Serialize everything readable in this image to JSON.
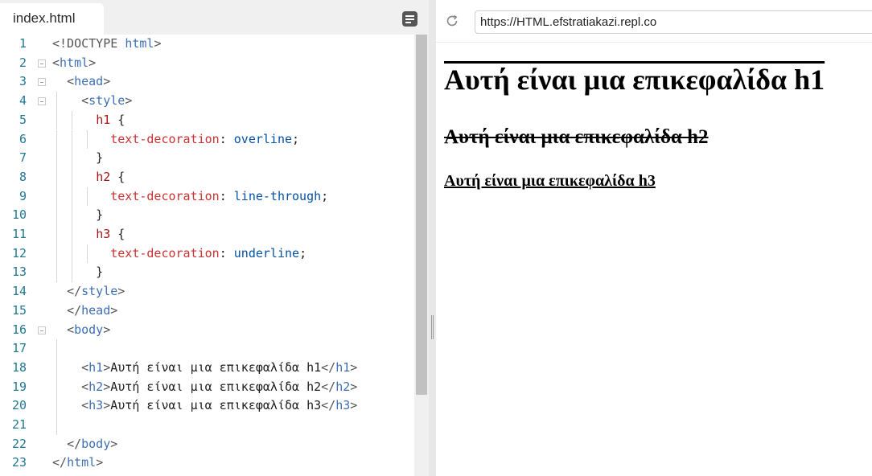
{
  "editor": {
    "filename": "index.html",
    "menu_icon": "menu-icon",
    "lines": [
      {
        "no": "1",
        "fold": false,
        "guides": [],
        "tokens": [
          [
            "t-br",
            "<!DOCTYPE "
          ],
          [
            "t-tag",
            "html"
          ],
          [
            "t-br",
            ">"
          ]
        ]
      },
      {
        "no": "2",
        "fold": true,
        "guides": [],
        "tokens": [
          [
            "t-br",
            "<"
          ],
          [
            "t-tag",
            "html"
          ],
          [
            "t-br",
            ">"
          ]
        ]
      },
      {
        "no": "3",
        "fold": true,
        "guides": [],
        "tokens": [
          [
            "t-txt",
            "  "
          ],
          [
            "t-br",
            "<"
          ],
          [
            "t-tag",
            "head"
          ],
          [
            "t-br",
            ">"
          ]
        ]
      },
      {
        "no": "4",
        "fold": true,
        "guides": [
          1
        ],
        "tokens": [
          [
            "t-txt",
            "    "
          ],
          [
            "t-br",
            "<"
          ],
          [
            "t-tag",
            "style"
          ],
          [
            "t-br",
            ">"
          ]
        ]
      },
      {
        "no": "5",
        "fold": false,
        "guides": [
          1,
          2
        ],
        "tokens": [
          [
            "t-txt",
            "      "
          ],
          [
            "t-sel",
            "h1"
          ],
          [
            "t-txt",
            " {"
          ]
        ]
      },
      {
        "no": "6",
        "fold": false,
        "guides": [
          1,
          2,
          3
        ],
        "tokens": [
          [
            "t-txt",
            "        "
          ],
          [
            "t-prop",
            "text-decoration"
          ],
          [
            "t-txt",
            ": "
          ],
          [
            "t-val",
            "overline"
          ],
          [
            "t-txt",
            ";"
          ]
        ]
      },
      {
        "no": "7",
        "fold": false,
        "guides": [
          1,
          2
        ],
        "tokens": [
          [
            "t-txt",
            "      }"
          ]
        ]
      },
      {
        "no": "8",
        "fold": false,
        "guides": [
          1,
          2
        ],
        "tokens": [
          [
            "t-txt",
            "      "
          ],
          [
            "t-sel",
            "h2"
          ],
          [
            "t-txt",
            " {"
          ]
        ]
      },
      {
        "no": "9",
        "fold": false,
        "guides": [
          1,
          2,
          3
        ],
        "tokens": [
          [
            "t-txt",
            "        "
          ],
          [
            "t-prop",
            "text-decoration"
          ],
          [
            "t-txt",
            ": "
          ],
          [
            "t-val",
            "line-through"
          ],
          [
            "t-txt",
            ";"
          ]
        ]
      },
      {
        "no": "10",
        "fold": false,
        "guides": [
          1,
          2
        ],
        "tokens": [
          [
            "t-txt",
            "      }"
          ]
        ]
      },
      {
        "no": "11",
        "fold": false,
        "guides": [
          1,
          2
        ],
        "tokens": [
          [
            "t-txt",
            "      "
          ],
          [
            "t-sel",
            "h3"
          ],
          [
            "t-txt",
            " {"
          ]
        ]
      },
      {
        "no": "12",
        "fold": false,
        "guides": [
          1,
          2,
          3
        ],
        "tokens": [
          [
            "t-txt",
            "        "
          ],
          [
            "t-prop",
            "text-decoration"
          ],
          [
            "t-txt",
            ": "
          ],
          [
            "t-val",
            "underline"
          ],
          [
            "t-txt",
            ";"
          ]
        ]
      },
      {
        "no": "13",
        "fold": false,
        "guides": [
          1,
          2
        ],
        "tokens": [
          [
            "t-txt",
            "      }"
          ]
        ]
      },
      {
        "no": "14",
        "fold": false,
        "guides": [],
        "tokens": [
          [
            "t-txt",
            "  "
          ],
          [
            "t-br",
            "</"
          ],
          [
            "t-tag",
            "style"
          ],
          [
            "t-br",
            ">"
          ]
        ]
      },
      {
        "no": "15",
        "fold": false,
        "guides": [],
        "tokens": [
          [
            "t-txt",
            "  "
          ],
          [
            "t-br",
            "</"
          ],
          [
            "t-tag",
            "head"
          ],
          [
            "t-br",
            ">"
          ]
        ]
      },
      {
        "no": "16",
        "fold": true,
        "guides": [],
        "tokens": [
          [
            "t-txt",
            "  "
          ],
          [
            "t-br",
            "<"
          ],
          [
            "t-tag",
            "body"
          ],
          [
            "t-br",
            ">"
          ]
        ]
      },
      {
        "no": "17",
        "fold": false,
        "guides": [
          1
        ],
        "tokens": []
      },
      {
        "no": "18",
        "fold": false,
        "guides": [
          1
        ],
        "tokens": [
          [
            "t-txt",
            "    "
          ],
          [
            "t-br",
            "<"
          ],
          [
            "t-tag",
            "h1"
          ],
          [
            "t-br",
            ">"
          ],
          [
            "t-txt",
            "Αυτή είναι μια επικεφαλίδα h1"
          ],
          [
            "t-br",
            "</"
          ],
          [
            "t-tag",
            "h1"
          ],
          [
            "t-br",
            ">"
          ]
        ]
      },
      {
        "no": "19",
        "fold": false,
        "guides": [
          1
        ],
        "tokens": [
          [
            "t-txt",
            "    "
          ],
          [
            "t-br",
            "<"
          ],
          [
            "t-tag",
            "h2"
          ],
          [
            "t-br",
            ">"
          ],
          [
            "t-txt",
            "Αυτή είναι μια επικεφαλίδα h2"
          ],
          [
            "t-br",
            "</"
          ],
          [
            "t-tag",
            "h2"
          ],
          [
            "t-br",
            ">"
          ]
        ]
      },
      {
        "no": "20",
        "fold": false,
        "guides": [
          1
        ],
        "tokens": [
          [
            "t-txt",
            "    "
          ],
          [
            "t-br",
            "<"
          ],
          [
            "t-tag",
            "h3"
          ],
          [
            "t-br",
            ">"
          ],
          [
            "t-txt",
            "Αυτή είναι μια επικεφαλίδα h3"
          ],
          [
            "t-br",
            "</"
          ],
          [
            "t-tag",
            "h3"
          ],
          [
            "t-br",
            ">"
          ]
        ]
      },
      {
        "no": "21",
        "fold": false,
        "guides": [
          1
        ],
        "tokens": []
      },
      {
        "no": "22",
        "fold": false,
        "guides": [],
        "tokens": [
          [
            "t-txt",
            "  "
          ],
          [
            "t-br",
            "</"
          ],
          [
            "t-tag",
            "body"
          ],
          [
            "t-br",
            ">"
          ]
        ]
      },
      {
        "no": "23",
        "fold": false,
        "guides": [],
        "tokens": [
          [
            "t-br",
            "</"
          ],
          [
            "t-tag",
            "html"
          ],
          [
            "t-br",
            ">"
          ]
        ]
      }
    ]
  },
  "preview": {
    "reload_icon": "reload-icon",
    "url": "https://HTML.efstratiakazi.repl.co",
    "h1": "Αυτή είναι μια επικεφαλίδα h1",
    "h2": "Αυτή είναι μια επικεφαλίδα h2",
    "h3": "Αυτή είναι μια επικεφαλίδα h3"
  }
}
